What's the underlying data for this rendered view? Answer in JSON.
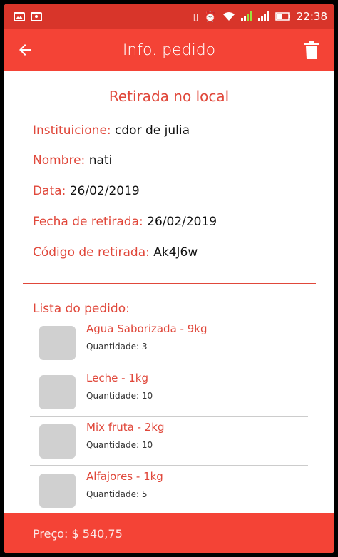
{
  "status": {
    "time": "22:38"
  },
  "appbar": {
    "title": "Info. pedido"
  },
  "order": {
    "type": "Retirada no local",
    "fields": [
      {
        "label": "Instituicione:",
        "value": "cdor de julia"
      },
      {
        "label": "Nombre:",
        "value": "nati"
      },
      {
        "label": "Data:",
        "value": "26/02/2019"
      },
      {
        "label": "Fecha de retirada:",
        "value": "26/02/2019"
      },
      {
        "label": "Código de retirada:",
        "value": "Ak4J6w"
      }
    ]
  },
  "list": {
    "title": "Lista do pedido:",
    "items": [
      {
        "name": "Agua Saborizada - 9kg",
        "qty": "Quantidade: 3"
      },
      {
        "name": "Leche - 1kg",
        "qty": "Quantidade: 10"
      },
      {
        "name": "Mix fruta - 2kg",
        "qty": "Quantidade: 10"
      },
      {
        "name": "Alfajores - 1kg",
        "qty": "Quantidade: 5"
      }
    ]
  },
  "footer": {
    "price": "Preço: $ 540,75"
  },
  "colors": {
    "primary": "#f44336",
    "status": "#d8352a",
    "accent": "#e0473a"
  }
}
